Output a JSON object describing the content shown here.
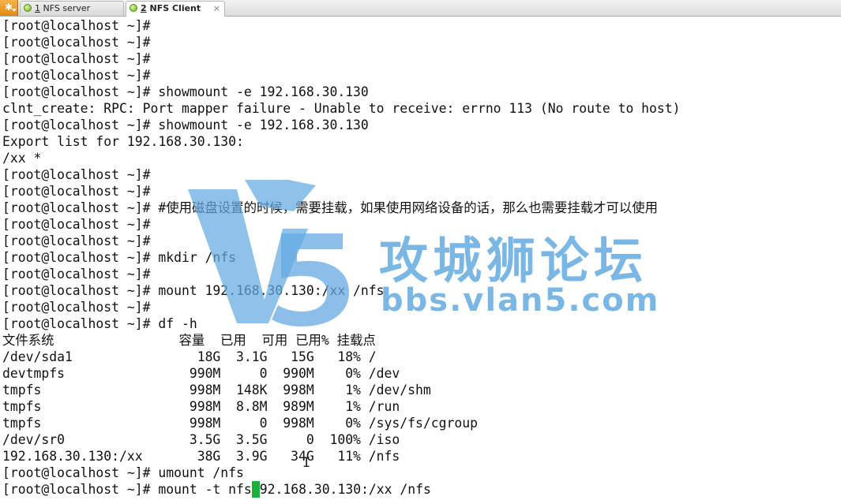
{
  "tabs": [
    {
      "number": "1",
      "label": "NFS server"
    },
    {
      "number": "2",
      "label": "NFS Client",
      "close": "×"
    }
  ],
  "watermark": {
    "name": "攻城狮论坛",
    "url": "bbs.vlan5.com"
  },
  "terminal": {
    "lines": [
      "[root@localhost ~]#",
      "[root@localhost ~]#",
      "[root@localhost ~]#",
      "[root@localhost ~]#",
      "[root@localhost ~]# showmount -e 192.168.30.130",
      "clnt_create: RPC: Port mapper failure - Unable to receive: errno 113 (No route to host)",
      "[root@localhost ~]# showmount -e 192.168.30.130",
      "Export list for 192.168.30.130:",
      "/xx *",
      "[root@localhost ~]#",
      "[root@localhost ~]#",
      "[root@localhost ~]# #使用磁盘设置的时候，需要挂载，如果使用网络设备的话，那么也需要挂载才可以使用",
      "[root@localhost ~]#",
      "[root@localhost ~]#",
      "[root@localhost ~]# mkdir /nfs",
      "[root@localhost ~]#",
      "[root@localhost ~]# mount 192.168.30.130:/xx /nfs",
      "[root@localhost ~]#",
      "[root@localhost ~]# df -h",
      "文件系统                容量  已用  可用 已用% 挂载点",
      "/dev/sda1                18G  3.1G   15G   18% /",
      "devtmpfs                990M     0  990M    0% /dev",
      "tmpfs                   998M  148K  998M    1% /dev/shm",
      "tmpfs                   998M  8.8M  989M    1% /run",
      "tmpfs                   998M     0  998M    0% /sys/fs/cgroup",
      "/dev/sr0                3.5G  3.5G     0  100% /iso",
      "192.168.30.130:/xx       38G  3.9G   34G   11% /nfs",
      "[root@localhost ~]# umount /nfs"
    ],
    "current_input_before": "[root@localhost ~]# mount -t nfs",
    "current_input_cursor": "1",
    "current_input_after": "92.168.30.130:/xx /nfs"
  }
}
